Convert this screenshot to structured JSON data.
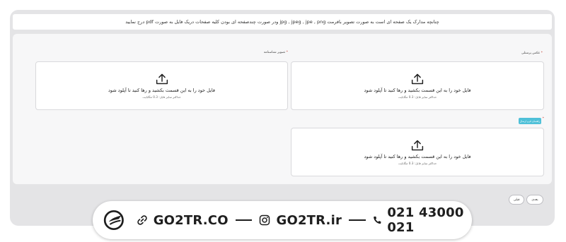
{
  "notice": {
    "text": "چنانچه مدارک یک صفحه ای است به صورت تصویر بافرمت jpg , jpeg , jpe , png ودر صورت چندصفحه ای بودن کلیه صفحات دریک فایل به صورت pdf درج نمایید"
  },
  "fields": {
    "passport": {
      "label": "عکس پرسنلی",
      "required_mark": "*"
    },
    "id_card": {
      "label": "تصویر شناسنامه",
      "required_mark": "*"
    },
    "third": {
      "required_mark": "*",
      "help_chip": "راهنمای فرم ارسال"
    }
  },
  "dropzone": {
    "main_text": "فایل خود را به این قسمت بکشید و رها کنید تا آپلود شود",
    "max_size_text": "حداکثر سایز فایل: 0.3 مگابایت"
  },
  "buttons": {
    "next": "بعدی",
    "prev": "قبلی"
  },
  "contact": {
    "website": "GO2TR.CO",
    "instagram": "GO2TR.ir",
    "phone": "021 43000 021"
  }
}
